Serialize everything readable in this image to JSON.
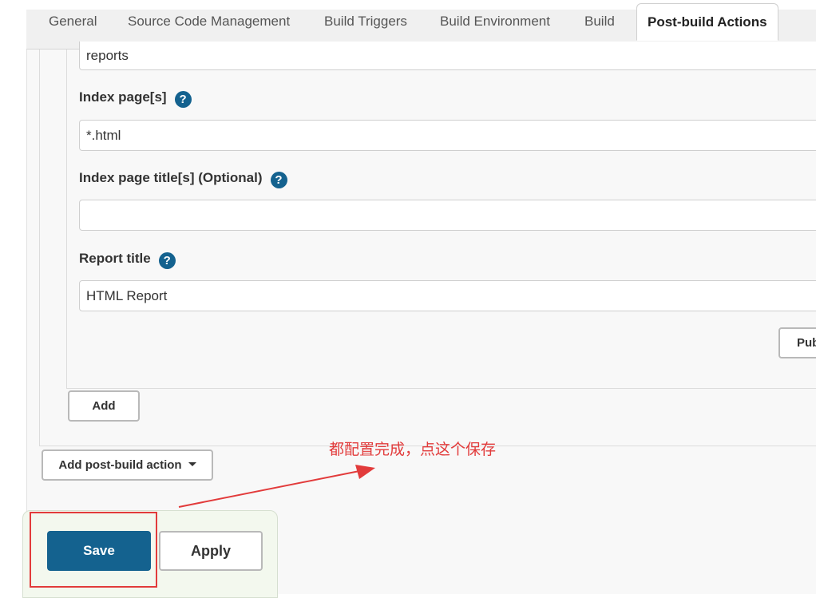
{
  "tabs": [
    {
      "label": "General",
      "active": false
    },
    {
      "label": "Source Code Management",
      "active": false
    },
    {
      "label": "Build Triggers",
      "active": false
    },
    {
      "label": "Build Environment",
      "active": false
    },
    {
      "label": "Build",
      "active": false
    },
    {
      "label": "Post-build Actions",
      "active": true
    }
  ],
  "publish_html": {
    "report_dir_value": "reports",
    "index_pages": {
      "label": "Index page[s]",
      "value": "*.html"
    },
    "index_page_titles": {
      "label": "Index page title[s] (Optional)",
      "value": ""
    },
    "report_title": {
      "label": "Report title",
      "value": "HTML Report"
    },
    "publish_button_label": "Pub",
    "add_button_label": "Add"
  },
  "add_post_build_action_label": "Add post-build action",
  "save_label": "Save",
  "apply_label": "Apply",
  "annotation_text": "都配置完成，点这个保存",
  "help_icon_glyph": "?",
  "colors": {
    "primary": "#14628f",
    "annotation_red": "#e23b3b",
    "active_tab_bg": "#ffffff"
  }
}
